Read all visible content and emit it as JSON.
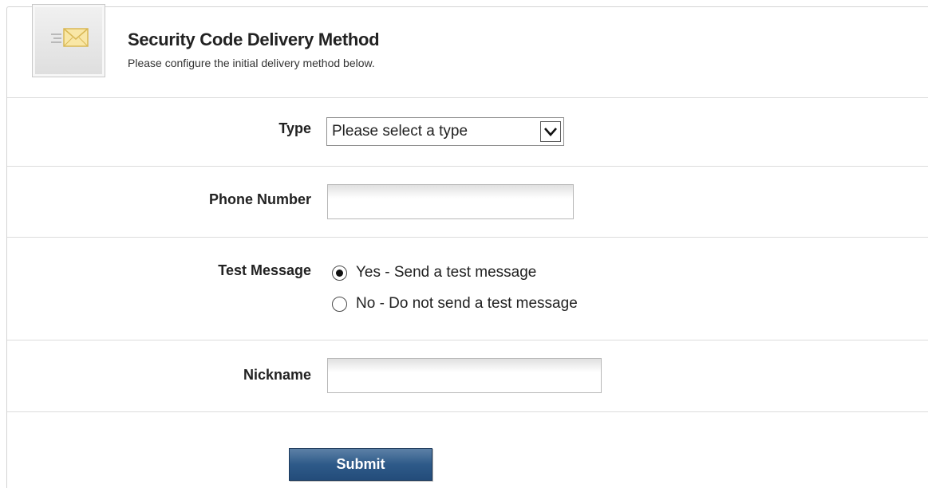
{
  "header": {
    "title": "Security Code Delivery Method",
    "subtitle": "Please configure the initial delivery method below.",
    "icon": "envelope-icon"
  },
  "form": {
    "type": {
      "label": "Type",
      "selected": "Please select a type"
    },
    "phone_number": {
      "label": "Phone Number",
      "value": ""
    },
    "test_message": {
      "label": "Test Message",
      "options": [
        {
          "label": "Yes - Send a test message",
          "checked": true
        },
        {
          "label": "No - Do not send a test message",
          "checked": false
        }
      ]
    },
    "nickname": {
      "label": "Nickname",
      "value": ""
    },
    "submit_label": "Submit"
  },
  "colors": {
    "submit_background": "#2e5a89",
    "divider": "#dcdcdc"
  }
}
